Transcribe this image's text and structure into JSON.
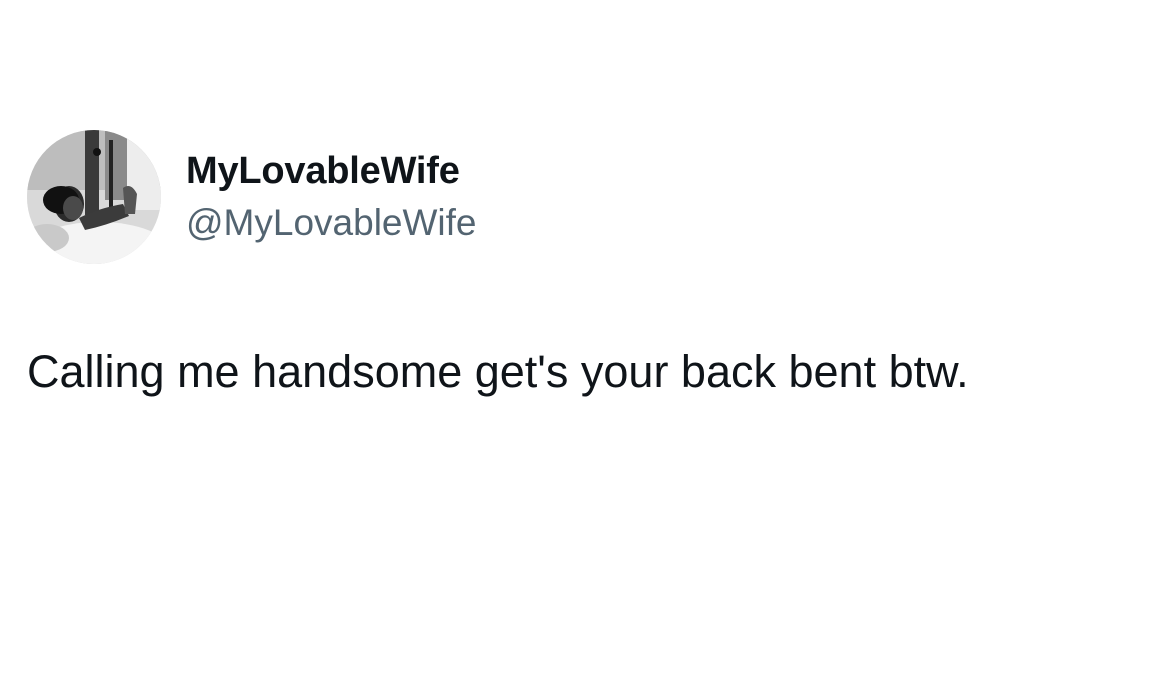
{
  "tweet": {
    "display_name": "MyLovableWife",
    "handle": "@MyLovableWife",
    "text": "Calling me handsome get's your back bent btw."
  },
  "avatar": {
    "icon": "profile-photo-avatar",
    "style": "black-and-white photo"
  },
  "colors": {
    "background": "#ffffff",
    "primary_text": "#0f1419",
    "secondary_text": "#536471"
  }
}
